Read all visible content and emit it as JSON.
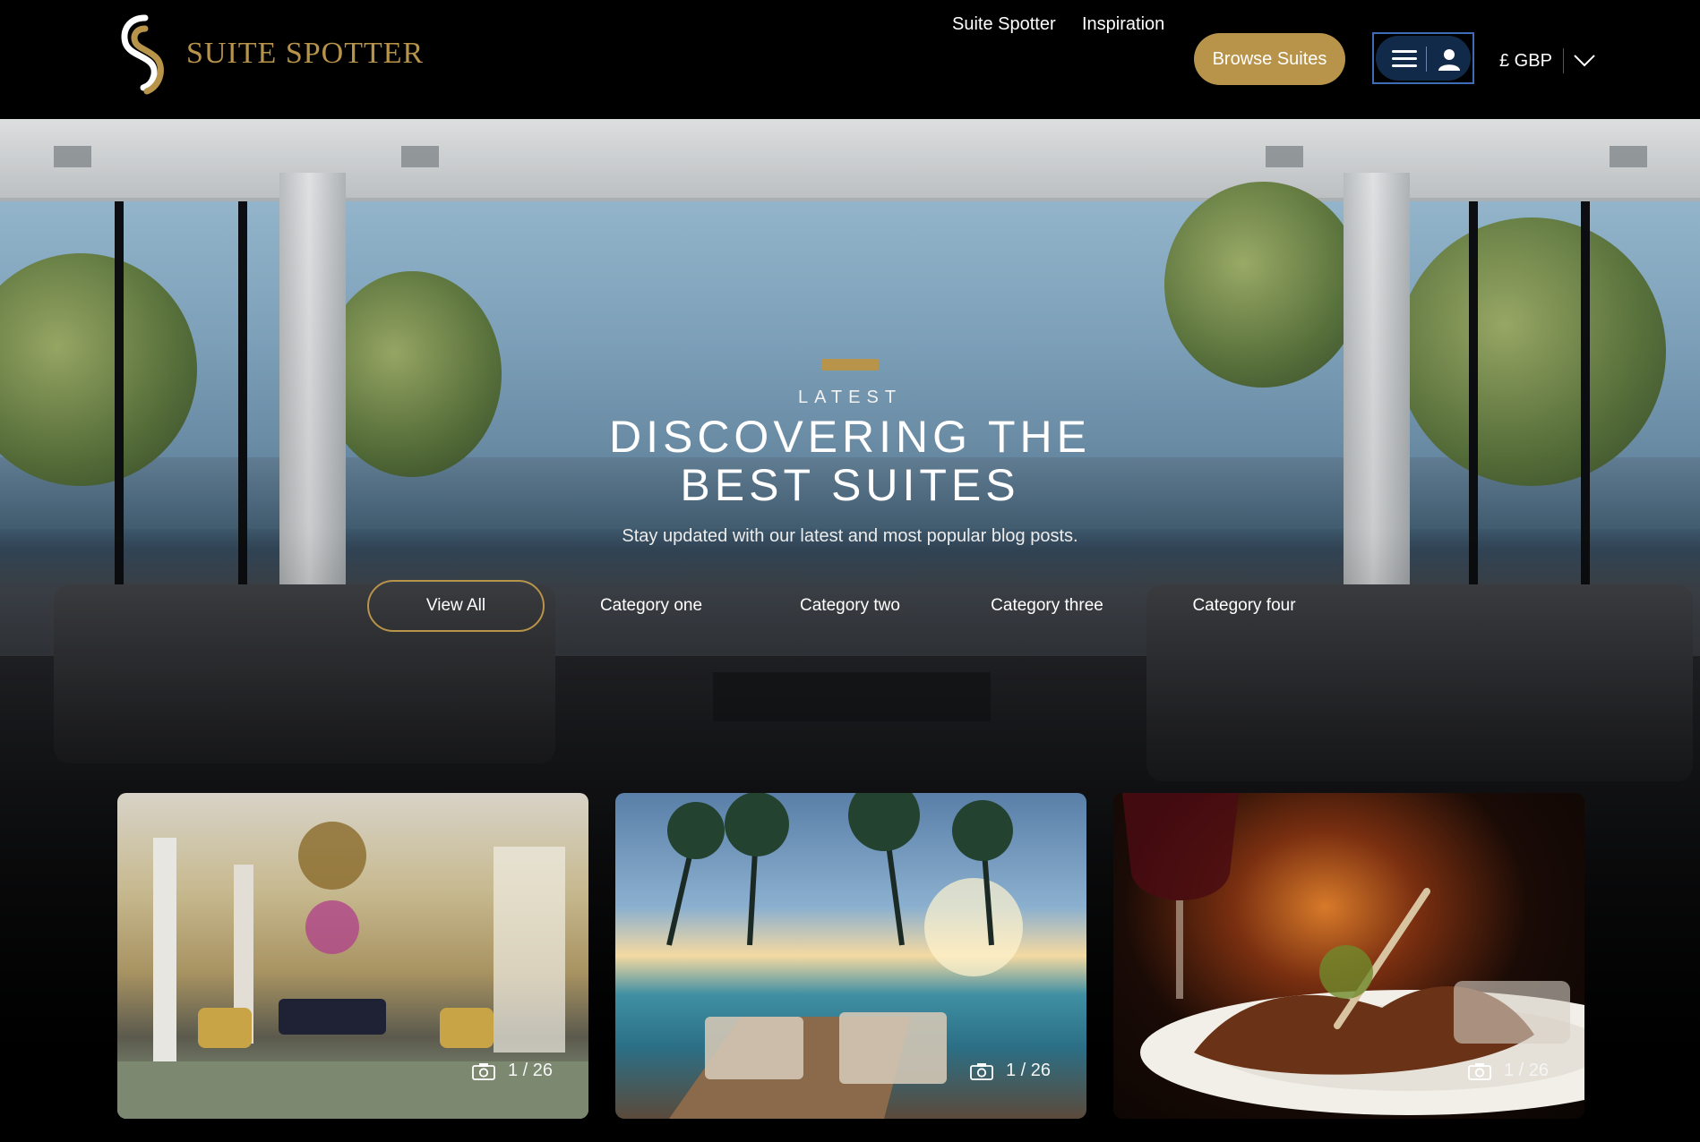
{
  "header": {
    "brand": "SUITE SPOTTER",
    "nav_links": [
      "Suite Spotter",
      "Inspiration"
    ],
    "browse_button": "Browse Suites",
    "currency": "£ GBP"
  },
  "hero": {
    "eyebrow": "LATEST",
    "title_line1": "DISCOVERING THE",
    "title_line2": "BEST SUITES",
    "subtitle": "Stay updated with our latest and most popular blog posts.",
    "categories": [
      "View All",
      "Category one",
      "Category two",
      "Category three",
      "Category four"
    ],
    "active_category": "View All"
  },
  "cards": [
    {
      "counter": "1 / 26"
    },
    {
      "counter": "1 / 26"
    },
    {
      "counter": "1 / 26"
    }
  ],
  "colors": {
    "brand_gold": "#b8944a",
    "menu_bg": "#122a4a",
    "menu_border": "#3d6db5"
  },
  "icons": [
    "logo-mark-icon",
    "hamburger-icon",
    "user-icon",
    "chevron-down-icon",
    "camera-icon"
  ]
}
